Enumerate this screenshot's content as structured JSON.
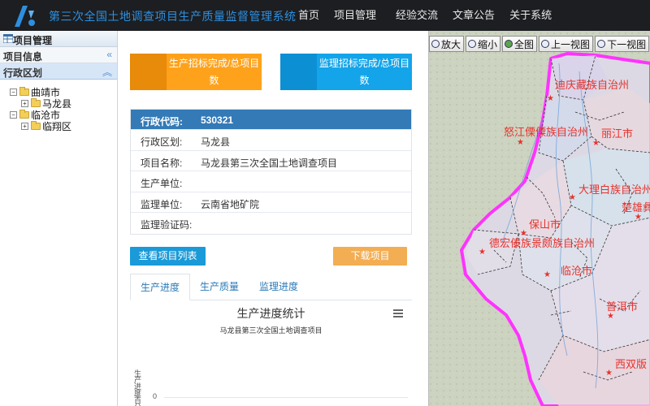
{
  "header": {
    "title": "第三次全国土地调查项目生产质量监督管理系统",
    "nav": [
      "首页",
      "项目管理",
      "经验交流",
      "文章公告",
      "关于系统"
    ]
  },
  "left_panel": {
    "title": "项目管理",
    "sections": [
      {
        "title": "项目信息",
        "toggle": "«"
      },
      {
        "title": "行政区划",
        "toggle": "«"
      }
    ],
    "tree": [
      {
        "label": "曲靖市",
        "children": [
          "马龙县"
        ]
      },
      {
        "label": "临沧市",
        "children": [
          "临翔区"
        ]
      }
    ]
  },
  "stats": {
    "production": "生产招标完成/总项目数",
    "supervision": "监理招标完成/总项目数"
  },
  "info": [
    {
      "key": "行政代码:",
      "value": "530321"
    },
    {
      "key": "行政区划:",
      "value": "马龙县"
    },
    {
      "key": "项目名称:",
      "value": "马龙县第三次全国土地调查项目"
    },
    {
      "key": "生产单位:",
      "value": ""
    },
    {
      "key": "监理单位:",
      "value": "云南省地矿院"
    },
    {
      "key": "监理验证码:",
      "value": ""
    }
  ],
  "buttons": {
    "list": "查看项目列表",
    "download": "下载项目"
  },
  "tabs": [
    "生产进度",
    "生产质量",
    "监理进度"
  ],
  "chart": {
    "title": "生产进度统计",
    "subtitle": "马龙县第三次全国土地调查项目",
    "y_title": "生产进度/百分比",
    "y_zero": "0"
  },
  "chart_data": {
    "type": "bar",
    "title": "生产进度统计",
    "subtitle": "马龙县第三次全国土地调查项目",
    "ylabel": "生产进度/百分比",
    "categories": [],
    "values": [],
    "y_ticks_visible": [
      0
    ]
  },
  "map": {
    "tools": [
      "放大",
      "缩小",
      "全图",
      "上一视图",
      "下一视图"
    ],
    "cities": [
      "迪庆藏族自治州",
      "怒江傈僳族自治州",
      "丽江市",
      "大理白族自治州",
      "楚雄彝",
      "保山市",
      "德宏傣族景颇族自治州",
      "临沧市",
      "普洱市",
      "西双版"
    ],
    "boundary_color": "#ff33ff",
    "label_color": "#e8322d"
  }
}
